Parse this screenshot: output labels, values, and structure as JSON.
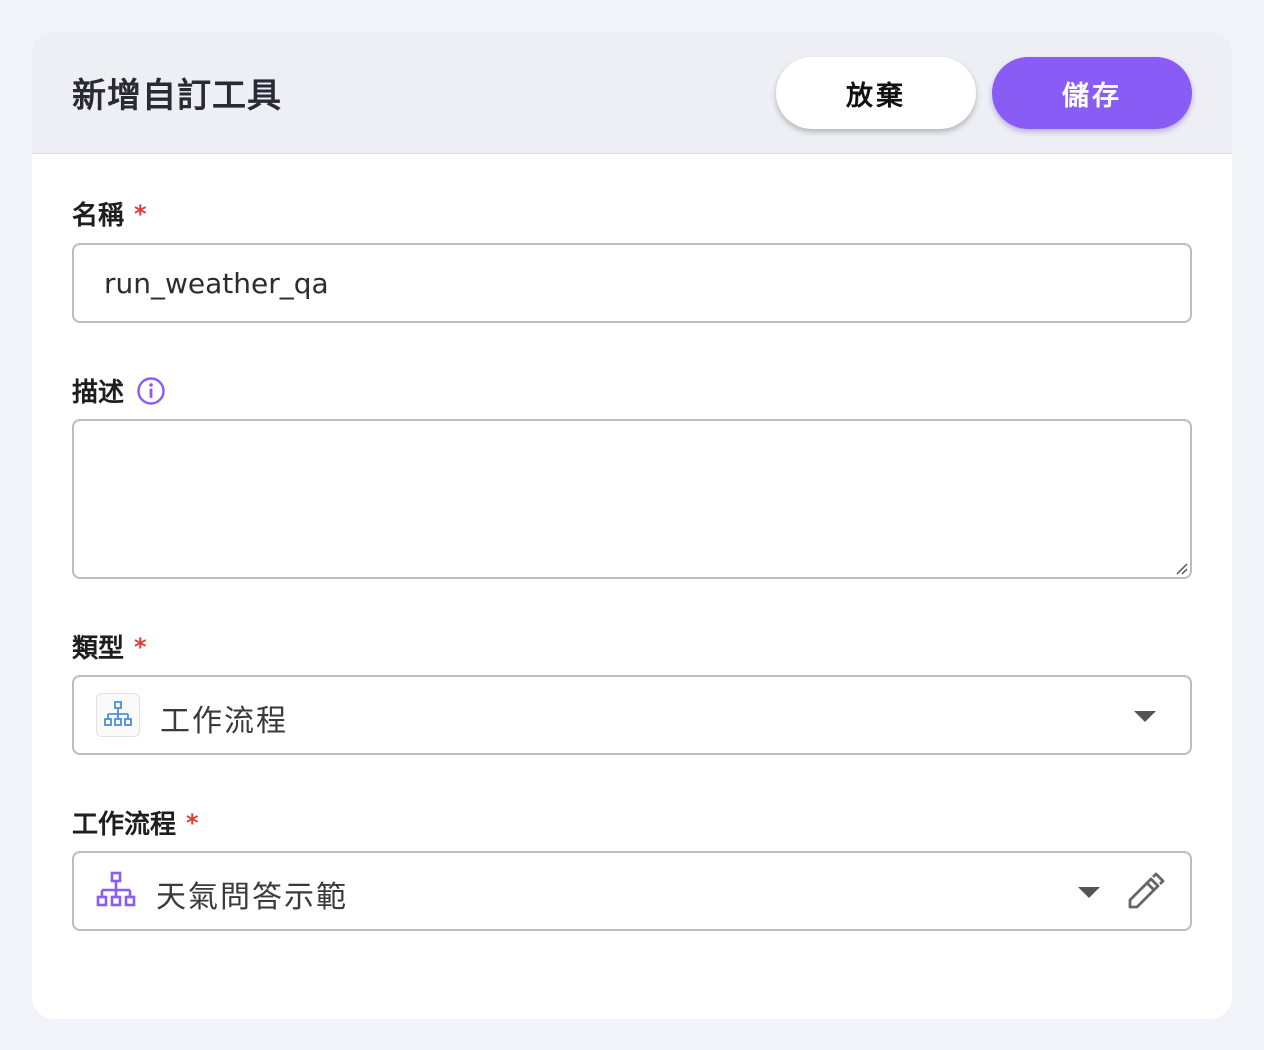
{
  "header": {
    "title": "新增自訂工具",
    "discard_label": "放棄",
    "save_label": "儲存"
  },
  "fields": {
    "name": {
      "label": "名稱",
      "required_mark": "*",
      "value": "run_weather_qa"
    },
    "description": {
      "label": "描述",
      "value": "",
      "icon": "info-icon"
    },
    "type": {
      "label": "類型",
      "required_mark": "*",
      "value": "工作流程",
      "icon": "workflow-icon"
    },
    "workflow": {
      "label": "工作流程",
      "required_mark": "*",
      "value": "天氣問答示範",
      "icon": "workflow-icon",
      "edit_icon": "pencil-icon"
    }
  },
  "colors": {
    "accent": "#8a5cf6",
    "required": "#e53935",
    "type_icon": "#4a90d9"
  }
}
